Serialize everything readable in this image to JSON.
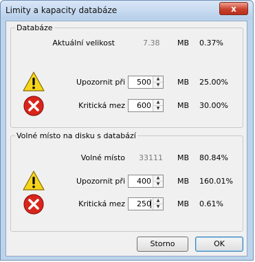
{
  "window": {
    "title": "Limity a kapacity databáze",
    "close_glyph": "x"
  },
  "database": {
    "legend": "Databáze",
    "current_label": "Aktuální velikost",
    "current_value": "7.38",
    "current_unit": "MB",
    "current_pct": "0.37%",
    "warn_label": "Upozornit při",
    "warn_value": "500",
    "warn_unit": "MB",
    "warn_pct": "25.00%",
    "crit_label": "Kritická mez",
    "crit_value": "600",
    "crit_unit": "MB",
    "crit_pct": "30.00%"
  },
  "disk": {
    "legend": "Volné místo na disku s databází",
    "free_label": "Volné místo",
    "free_value": "33111",
    "free_unit": "MB",
    "free_pct": "80.84%",
    "warn_label": "Upozornit při",
    "warn_value": "400",
    "warn_unit": "MB",
    "warn_pct": "160.01%",
    "crit_label": "Kritická mez",
    "crit_value": "250",
    "crit_unit": "MB",
    "crit_pct": "0.61%"
  },
  "buttons": {
    "cancel": "Storno",
    "ok": "OK"
  },
  "icons": {
    "warning": "warning-icon",
    "error": "error-icon"
  },
  "colors": {
    "warning_yellow": "#f5d51c",
    "error_red": "#d9251c",
    "title_bg": "#c9dcf2"
  }
}
